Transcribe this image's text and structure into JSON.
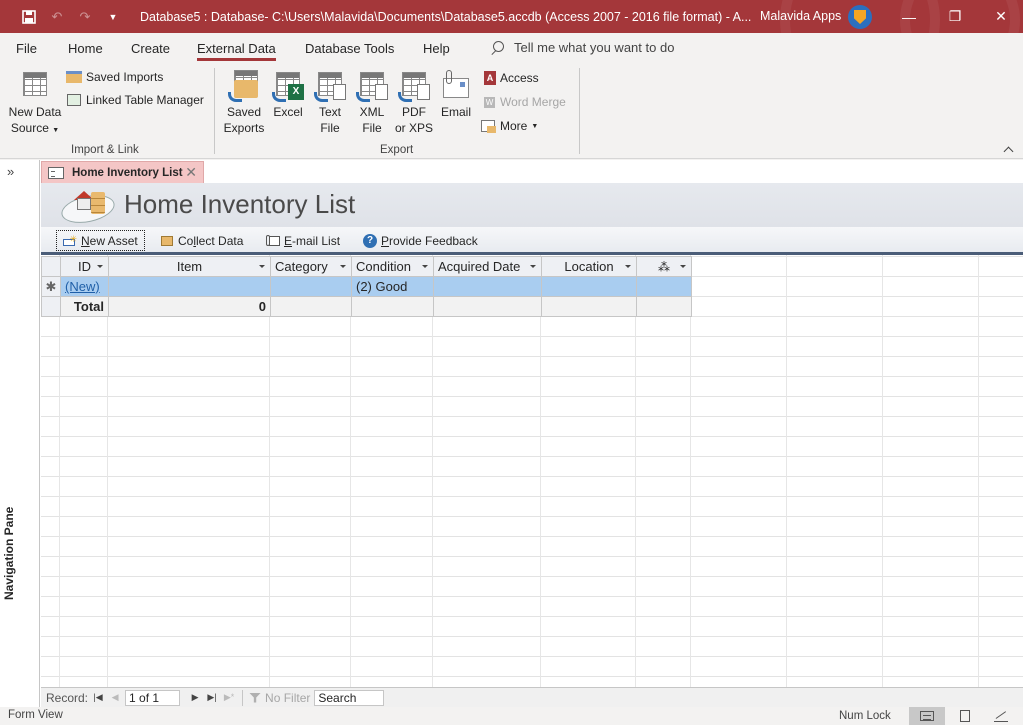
{
  "titlebar": {
    "title": "Database5 : Database- C:\\Users\\Malavida\\Documents\\Database5.accdb (Access 2007 - 2016 file format)  -  A...",
    "user": "Malavida Apps",
    "brand_color": "#a4373a",
    "minimize": "—",
    "restore": "❐",
    "close": "✕"
  },
  "qat": {
    "save": "💾",
    "undo": "↶",
    "redo": "↷",
    "customize": "⏷"
  },
  "menu": {
    "tabs": [
      {
        "label": "File"
      },
      {
        "label": "Home"
      },
      {
        "label": "Create"
      },
      {
        "label": "External Data",
        "active": true
      },
      {
        "label": "Database Tools"
      },
      {
        "label": "Help"
      }
    ],
    "tell_me": "Tell me what you want to do"
  },
  "ribbon": {
    "import_link": {
      "label": "Import & Link",
      "new_data_source": "New Data",
      "new_data_source_2": "Source",
      "saved_imports": "Saved Imports",
      "linked_table_manager": "Linked Table Manager"
    },
    "export": {
      "label": "Export",
      "saved_exports_1": "Saved",
      "saved_exports_2": "Exports",
      "excel": "Excel",
      "text_file_1": "Text",
      "text_file_2": "File",
      "xml_file_1": "XML",
      "xml_file_2": "File",
      "pdf_1": "PDF",
      "pdf_2": "or XPS",
      "email": "Email",
      "access": "Access",
      "word_merge": "Word Merge",
      "more": "More"
    }
  },
  "nav_pane": {
    "toggle": "»",
    "label": "Navigation Pane"
  },
  "document": {
    "tab_label": "Home Inventory List",
    "tab_close": "✕",
    "form_title": "Home Inventory List",
    "toolbar": {
      "new_asset_u": "N",
      "new_asset_rest": "ew Asset",
      "collect_pre": "Co",
      "collect_u": "l",
      "collect_rest": "lect Data",
      "email_u": "E",
      "email_rest": "-mail List",
      "feedback_u": "P",
      "feedback_rest": "rovide Feedback"
    },
    "datasheet": {
      "columns": [
        "ID",
        "Item",
        "Category",
        "Condition",
        "Acquired Date",
        "Location",
        "📎"
      ],
      "new_row": {
        "selector": "✱",
        "id": "(New)",
        "item": "",
        "category": "",
        "condition": "(2) Good",
        "acquired_date": "",
        "location": "",
        "attachment": ""
      },
      "total_row": {
        "label": "Total",
        "item": "0"
      }
    },
    "record_nav": {
      "label": "Record:",
      "first": "⏮",
      "prev": "◀",
      "current": "1 of 1",
      "next": "▶",
      "last": "⏭",
      "new": "▶*",
      "filter": "No Filter",
      "search": "Search"
    }
  },
  "statusbar": {
    "left": "Form View",
    "numlock": "Num Lock"
  }
}
